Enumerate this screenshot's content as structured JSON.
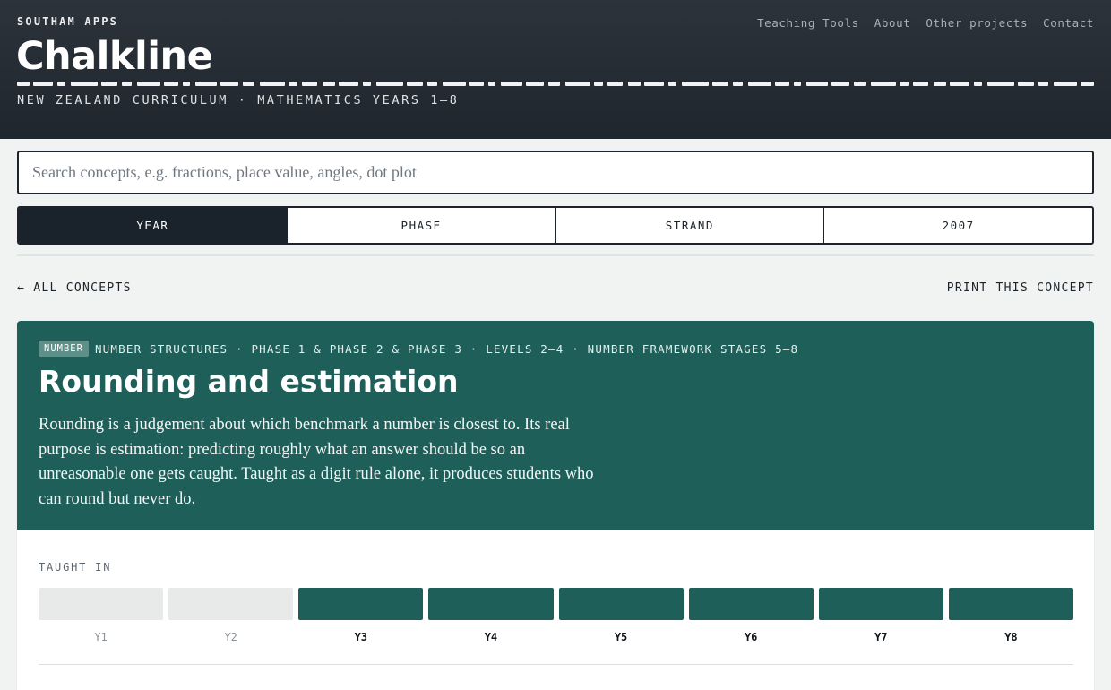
{
  "header": {
    "org": "SOUTHAM APPS",
    "title": "Chalkline",
    "subtitle": "NEW ZEALAND CURRICULUM · MATHEMATICS YEARS 1–8",
    "nav": [
      "Teaching Tools",
      "About",
      "Other projects",
      "Contact"
    ]
  },
  "search": {
    "placeholder": "Search concepts, e.g. fractions, place value, angles, dot plot",
    "value": ""
  },
  "tabs": [
    {
      "label": "YEAR",
      "active": true
    },
    {
      "label": "PHASE",
      "active": false
    },
    {
      "label": "STRAND",
      "active": false
    },
    {
      "label": "2007",
      "active": false
    }
  ],
  "actions": {
    "back": "← ALL CONCEPTS",
    "print": "PRINT THIS CONCEPT"
  },
  "concept": {
    "strand_badge": "NUMBER",
    "meta": "NUMBER STRUCTURES · PHASE 1 & PHASE 2 & PHASE 3 · LEVELS 2–4 · NUMBER FRAMEWORK STAGES 5–8",
    "title": "Rounding and estimation",
    "description": "Rounding is a judgement about which benchmark a number is closest to. Its real purpose is estimation: predicting roughly what an answer should be so an unreasonable one gets caught. Taught as a digit rule alone, it produces students who can round but never do.",
    "taught_in_label": "TAUGHT IN",
    "years": [
      {
        "label": "Y1",
        "taught": false
      },
      {
        "label": "Y2",
        "taught": false
      },
      {
        "label": "Y3",
        "taught": true
      },
      {
        "label": "Y4",
        "taught": true
      },
      {
        "label": "Y5",
        "taught": true
      },
      {
        "label": "Y6",
        "taught": true
      },
      {
        "label": "Y7",
        "taught": true
      },
      {
        "label": "Y8",
        "taught": true
      }
    ]
  },
  "colors": {
    "header_bg": "#222a32",
    "accent_teal": "#1f5f5a",
    "active_tab": "#1a222b",
    "page_bg": "#f1f3f2"
  }
}
